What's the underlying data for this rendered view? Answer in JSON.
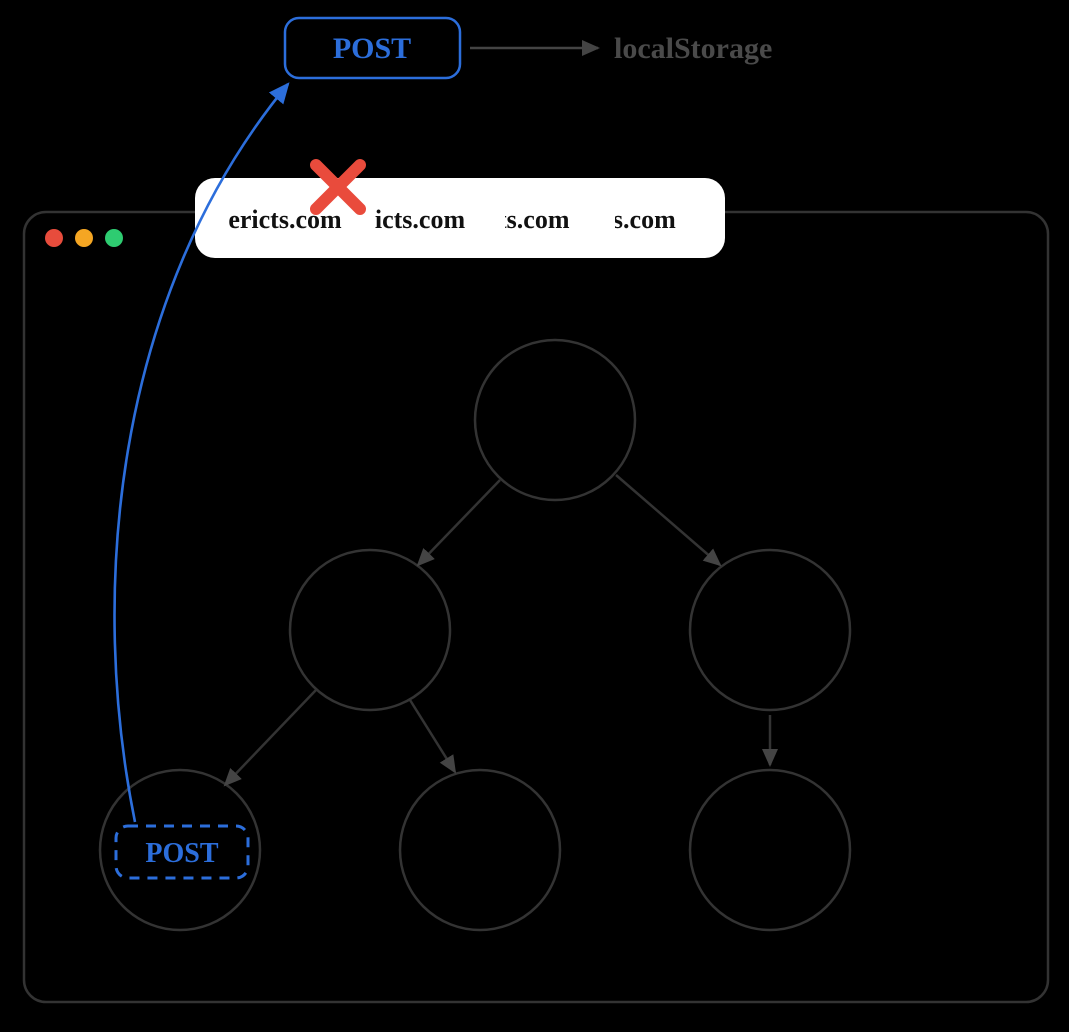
{
  "top_box": {
    "label": "POST",
    "color": "#2c6edb"
  },
  "local_storage_label": "localStorage",
  "browser": {
    "traffic_lights": [
      "#e74c3c",
      "#f5a623",
      "#2ecc71"
    ],
    "tabs": [
      "ericts.com",
      "icts.com",
      "cts.com",
      "ts.com"
    ]
  },
  "inner_post": {
    "label": "POST",
    "color": "#2c6edb"
  },
  "colors": {
    "dim": "#3a3a3a",
    "dimmer": "#2a2a2a",
    "blue": "#2c6edb",
    "red": "#e94b3c",
    "white": "#ffffff",
    "black": "#000000"
  }
}
